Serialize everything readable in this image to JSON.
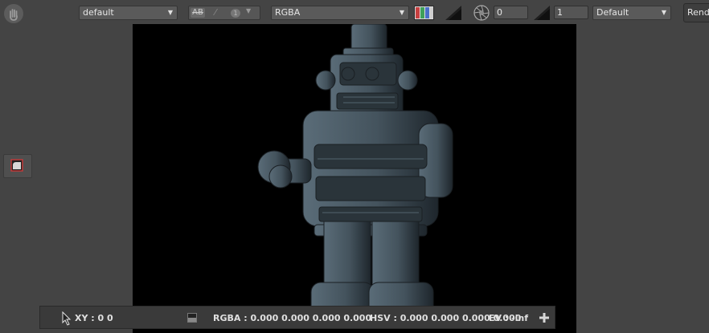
{
  "toolbar": {
    "display_select": "default",
    "compare_labels": {
      "ab": "AB",
      "wipe": "⁄",
      "index": "1"
    },
    "channel_select": "RGBA",
    "exposure_value": "0",
    "gamma_value": "1",
    "view_transform_select": "Default",
    "render_button": "Rend"
  },
  "status": {
    "xy": "XY : 0 0",
    "rgba": "RGBA : 0.000 0.000 0.000 0.000",
    "hsv": "HSV : 0.000 0.000 0.000 0.000",
    "ev": "EV : -inf"
  },
  "colors": {
    "background": "#444444",
    "viewport": "#000000",
    "robot": "#4a5b66",
    "channel_red": "#c64040",
    "channel_green": "#3fa05a",
    "channel_blue": "#4a6fc8"
  },
  "icons": [
    "hand-icon",
    "chevron-down-icon",
    "channel-bars-icon",
    "exposure-ramp-icon",
    "aperture-icon",
    "gamma-ramp-icon",
    "region-tool-icon",
    "cursor-icon",
    "swatch-icon",
    "plus-icon"
  ]
}
